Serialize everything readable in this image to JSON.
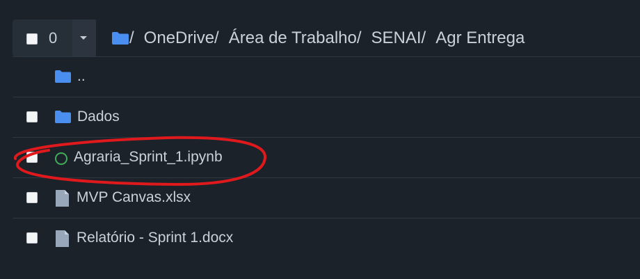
{
  "header": {
    "selected_count": "0",
    "breadcrumb": [
      {
        "label": "OneDrive"
      },
      {
        "label": "Área de Trabalho"
      },
      {
        "label": "SENAI"
      },
      {
        "label": "Agr Entrega"
      }
    ]
  },
  "files": [
    {
      "name": "..",
      "icon": "folder-icon",
      "checkbox": false
    },
    {
      "name": "Dados",
      "icon": "folder-icon",
      "checkbox": true
    },
    {
      "name": "Agraria_Sprint_1.ipynb",
      "icon": "notebook-status-icon",
      "checkbox": true,
      "highlighted": true
    },
    {
      "name": "MVP Canvas.xlsx",
      "icon": "file-icon",
      "checkbox": true
    },
    {
      "name": "Relatório - Sprint 1.docx",
      "icon": "file-icon",
      "checkbox": true
    }
  ],
  "colors": {
    "background": "#1b222a",
    "text": "#c9d1d9",
    "folder": "#4a8ff0",
    "notebook_status": "#3fae5a",
    "annotation": "#e0191c"
  }
}
